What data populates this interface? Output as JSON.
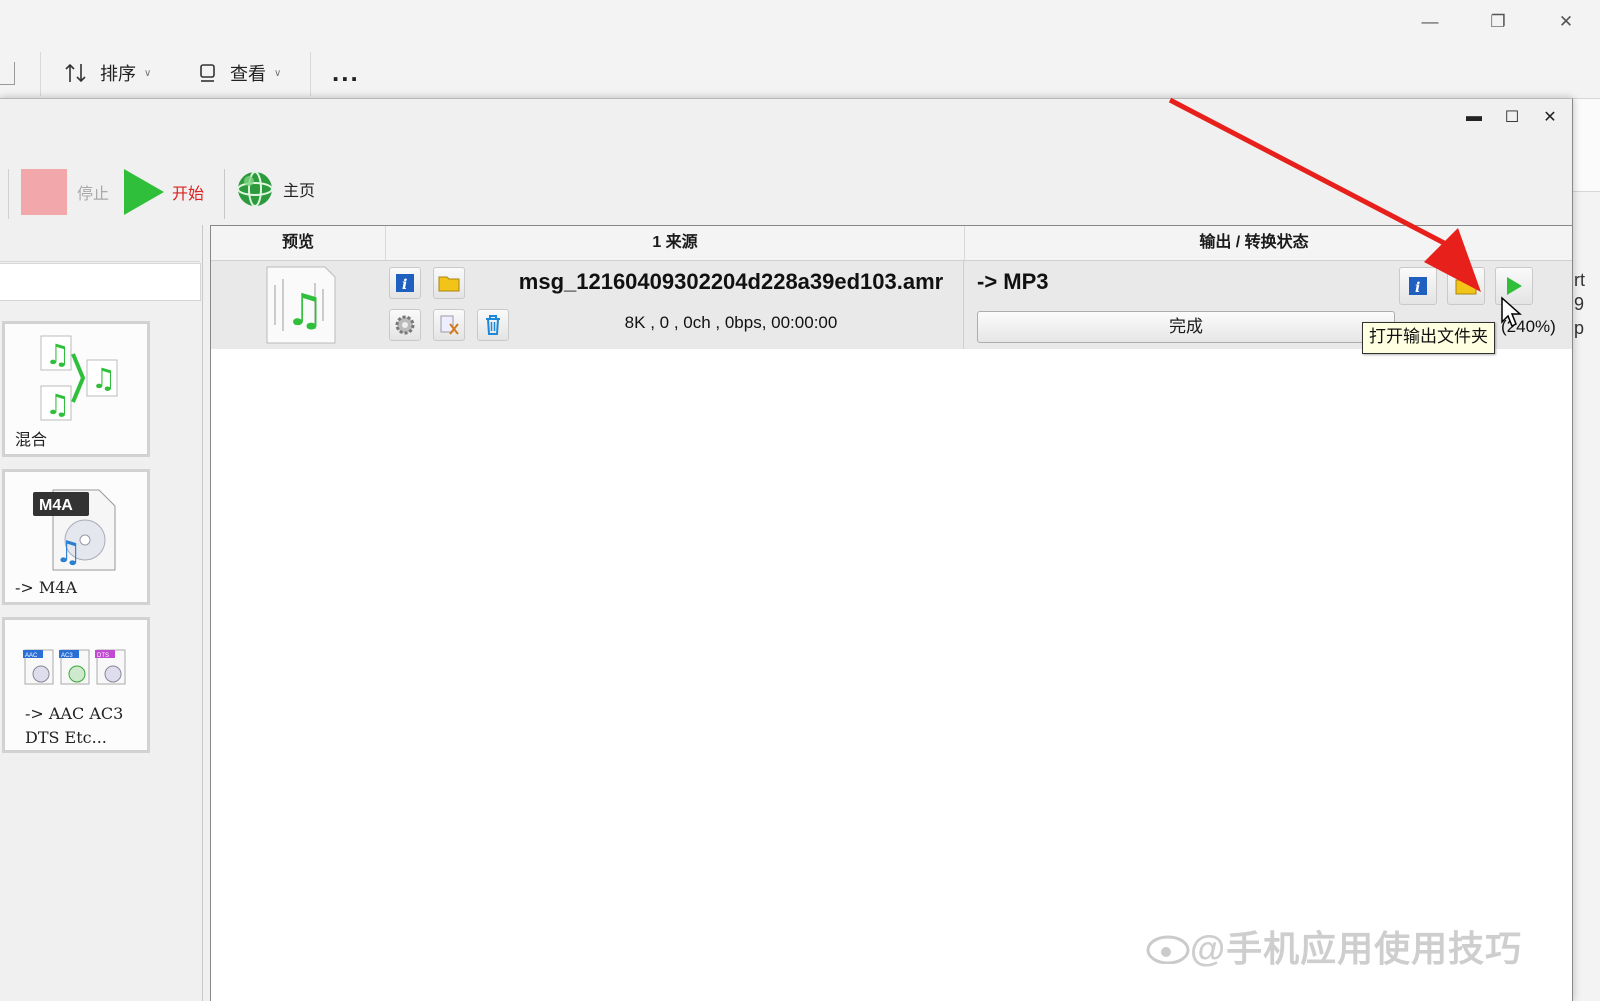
{
  "background_window": {
    "toolbar": {
      "sort_label": "排序",
      "view_label": "查看",
      "more_label": "..."
    },
    "right_edge_text": [
      "rt",
      "9",
      "p"
    ]
  },
  "app": {
    "toolbar": {
      "stop_label": "停止",
      "start_label": "开始",
      "home_label": "主页"
    },
    "left_panel": {
      "cards": [
        {
          "label": "混合"
        },
        {
          "label": "-> M4A",
          "badge": "M4A"
        },
        {
          "label_line1": "-> AAC AC3",
          "label_line2": "DTS Etc...",
          "mini_badges": [
            "AAC",
            "AC3",
            "DTS"
          ]
        }
      ]
    },
    "table": {
      "headers": {
        "preview": "预览",
        "source": "1 来源",
        "output": "输出 / 转换状态"
      },
      "rows": [
        {
          "filename": "msg_12160409302204d228a39ed103.amr",
          "info": "8K , 0 , 0ch , 0bps, 00:00:00",
          "output_format": "-> MP3",
          "status": "完成",
          "ratio": "(240%)"
        }
      ]
    },
    "tooltip": "打开输出文件夹"
  },
  "watermark": "@手机应用使用技巧",
  "colors": {
    "accent_red": "#e8201b",
    "start_green": "#2fbf3a",
    "stop_pink": "#f2a8aa",
    "info_blue": "#1f5fbf",
    "folder_yellow": "#f2c418"
  }
}
